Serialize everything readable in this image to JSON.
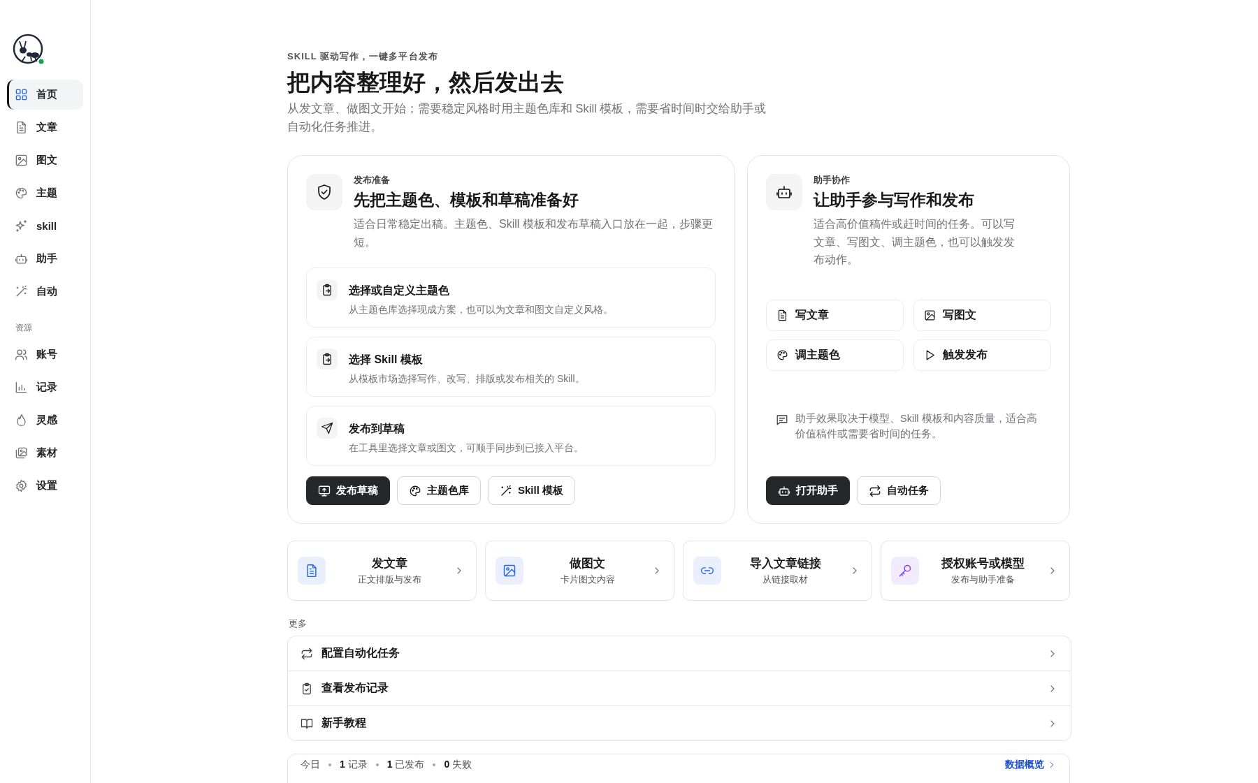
{
  "sidebar": {
    "nav": [
      {
        "label": "首页",
        "selected": true
      },
      {
        "label": "文章",
        "selected": false
      },
      {
        "label": "图文",
        "selected": false
      },
      {
        "label": "主题",
        "selected": false
      },
      {
        "label": "skill",
        "selected": false
      },
      {
        "label": "助手",
        "selected": false
      },
      {
        "label": "自动",
        "selected": false
      }
    ],
    "section_label": "资源",
    "resources": [
      {
        "label": "账号",
        "selected": false
      },
      {
        "label": "记录",
        "selected": false
      },
      {
        "label": "灵感",
        "selected": false
      },
      {
        "label": "素材",
        "selected": false
      },
      {
        "label": "设置",
        "selected": false
      }
    ]
  },
  "header": {
    "eyebrow": "SKILL 驱动写作，一键多平台发布",
    "title": "把内容整理好，然后发出去",
    "description": "从发文章、做图文开始；需要稳定风格时用主题色库和 Skill 模板，需要省时间时交给助手或自动化任务推进。"
  },
  "publish_card": {
    "eyebrow": "发布准备",
    "title": "先把主题色、模板和草稿准备好",
    "description": "适合日常稳定出稿。主题色、Skill 模板和发布草稿入口放在一起，步骤更短。",
    "steps": [
      {
        "title": "选择或自定义主题色",
        "description": "从主题色库选择现成方案，也可以为文章和图文自定义风格。"
      },
      {
        "title": "选择 Skill 模板",
        "description": "从模板市场选择写作、改写、排版或发布相关的 Skill。"
      },
      {
        "title": "发布到草稿",
        "description": "在工具里选择文章或图文，可顺手同步到已接入平台。"
      }
    ],
    "buttons": [
      {
        "label": "发布草稿",
        "kind": "primary"
      },
      {
        "label": "主题色库",
        "kind": "secondary"
      },
      {
        "label": "Skill 模板",
        "kind": "secondary"
      }
    ]
  },
  "assistant_card": {
    "eyebrow": "助手协作",
    "title": "让助手参与写作和发布",
    "description": "适合高价值稿件或赶时间的任务。可以写文章、写图文、调主题色，也可以触发发布动作。",
    "actions": [
      "写文章",
      "写图文",
      "调主题色",
      "触发发布"
    ],
    "note": "助手效果取决于模型、Skill 模板和内容质量，适合高价值稿件或需要省时间的任务。",
    "buttons": [
      {
        "label": "打开助手",
        "kind": "primary"
      },
      {
        "label": "自动任务",
        "kind": "secondary"
      }
    ]
  },
  "quick_links": [
    {
      "title": "发文章",
      "subtitle": "正文排版与发布",
      "color": "#2563eb"
    },
    {
      "title": "做图文",
      "subtitle": "卡片图文内容",
      "color": "#2563eb"
    },
    {
      "title": "导入文章链接",
      "subtitle": "从链接取材",
      "color": "#2563eb"
    },
    {
      "title": "授权账号或模型",
      "subtitle": "发布与助手准备",
      "color": "#7c3aed"
    }
  ],
  "more": {
    "label": "更多",
    "items": [
      "配置自动化任务",
      "查看发布记录",
      "新手教程"
    ]
  },
  "today_bar": {
    "label": "今日",
    "stats": [
      "**1** 记录",
      "**1** 已发布",
      "**0** 失败"
    ],
    "link": "数据概览"
  }
}
